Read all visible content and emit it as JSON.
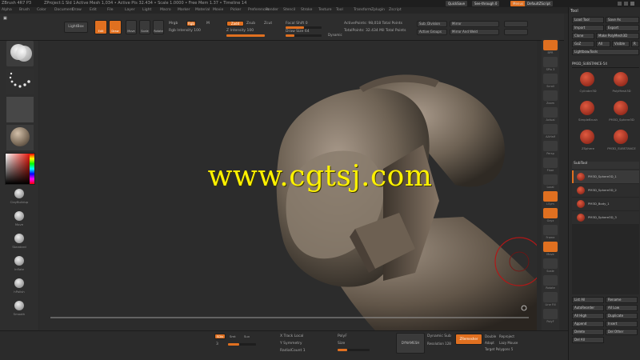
{
  "titlebar": {
    "app": "ZBrush 4R7 P3",
    "zproject": "ZProject:1 Sld 1",
    "info": "Active Mesh 1,034 • Active Pts 32.434 • Scale 1.0000 • Free Mem 1.37 • Timeline 14",
    "quicksave": "QuickSave",
    "seethrough": "See-through 0",
    "menus": "Menus",
    "ui": "DefaultZScript"
  },
  "menubar": {
    "items": [
      "Alpha",
      "Brush",
      "Color",
      "Document",
      "Draw",
      "Edit",
      "File",
      "Layer",
      "Light",
      "Macro",
      "Marker",
      "Material",
      "Movie",
      "Picker",
      "Preferences",
      "Render",
      "Stencil",
      "Stroke",
      "Texture",
      "Tool",
      "Transform",
      "Zplugin",
      "Zscript"
    ]
  },
  "shelf": {
    "lightbox": "LightBox",
    "edit": "Edit",
    "draw": "Draw",
    "move": "Move",
    "scale": "Scale",
    "rotate": "Rotate",
    "mrgb": "Mrgb",
    "rgb": "Rgb",
    "m": "M",
    "rgb_intensity": "Rgb Intensity 100",
    "zadd": "Zadd",
    "zsub": "Zsub",
    "zcut": "Zcut",
    "z_intensity": "Z Intensity 100",
    "focal_shift": "Focal Shift 0",
    "draw_size": "Draw Size 64",
    "dynamic": "Dynamic",
    "active_points": "ActivePoints: 98,018 Total Points",
    "total_points": "TotalPoints: 32.434 Mil Total Points",
    "subdiv": "Sub. Division",
    "mirror": "Mirror",
    "active_groups": "Active Groups",
    "mirror_weld": "Mirror And Weld"
  },
  "leftpanel": {
    "items": [
      "Standard",
      "Dots",
      "Alpha Off",
      "Texture Off",
      "MatCap Gray",
      "Gradient",
      "SwitchColor",
      "Alternate"
    ],
    "brush_labels": [
      "ClayBuildup",
      "Move",
      "Standard",
      "Inflate",
      "hPolish",
      "Smooth"
    ]
  },
  "rightstrip": {
    "labels": [
      "BPR",
      "SPix 3",
      "Scroll",
      "Zoom",
      "Actual",
      "AAHalf",
      "Persp",
      "Floor",
      "Local",
      "LSym",
      "Gxyz",
      "Frame",
      "Move",
      "Scale",
      "Rotate",
      "Line Fill",
      "PolyF",
      "Transp",
      "Ghost",
      "Solo",
      "Xpose"
    ]
  },
  "tray": {
    "header": "Tool",
    "buttons": [
      "Load Tool",
      "Save As",
      "Import",
      "Export",
      "Clone",
      "Make PolyMesh3D",
      "GoZ",
      "All",
      "Visible",
      "R",
      "Lightbox▸Tools"
    ],
    "current_tool": "PM3D_SUBSTANCE-54",
    "thumb_labels": [
      "Cylinder3D",
      "PolyMesh3D",
      "SimpleBrush",
      "PM3D_Sphere3D",
      "ZSphere",
      "PM3D_SUBSTANCE"
    ],
    "subtool_header": "SubTool",
    "subtools": [
      "PM3D_Sphere3D_1",
      "PM3D_Sphere3D_2",
      "PM3D_Body_1",
      "PM3D_Sphere3D_3"
    ],
    "empty_slots": [
      "List All",
      "Rename",
      "AutoReorder",
      "All Low",
      "All High",
      "Duplicate",
      "Append",
      "Insert",
      "Delete",
      "Del Other",
      "Del All"
    ]
  },
  "bottombar": {
    "modes": [
      "SDiv",
      "Smt",
      "Suv"
    ],
    "sdiv_val": "3",
    "xpose": "X Track Local",
    "ysym": "Y Symmetry",
    "rad_sym": "RadialCount 1",
    "polyf": "PolyF",
    "size": "Size",
    "dynamesh": "DYNAMESH",
    "resolution": "Resolution 128",
    "zremesher": "ZRemesher",
    "dynamic_sub": "Dynamic Sub",
    "target": "Target Polygons 5",
    "reproject": "Reproject",
    "lazy": "Lazy Mouse",
    "adapt": "Adapt",
    "double": "Double"
  },
  "watermark": "www.cgtsj.com",
  "colors": {
    "accent": "#e07020",
    "watermark": "#fff200",
    "background": "#2a2a2a"
  }
}
